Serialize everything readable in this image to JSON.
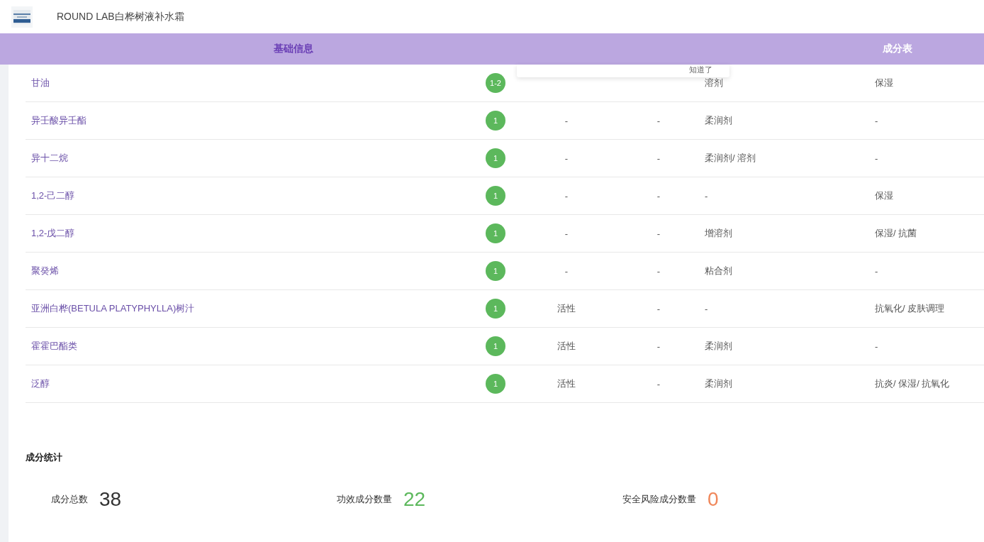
{
  "product": {
    "title": "ROUND LAB白桦树液补水霜"
  },
  "tabs": [
    {
      "label": "基础信息",
      "selected": true
    },
    {
      "label": "成分表",
      "selected": false
    }
  ],
  "popup": {
    "action": "知道了"
  },
  "ingredients": [
    {
      "name": "甘油",
      "score": "1-2",
      "column_5": "溶剂",
      "column_6": "保湿"
    },
    {
      "name": "异壬酸异壬酯",
      "score": "1",
      "column_3": "-",
      "column_4": "-",
      "column_5": "柔润剂",
      "column_6": "-"
    },
    {
      "name": "异十二烷",
      "score": "1",
      "column_3": "-",
      "column_4": "-",
      "column_5": "柔润剂/ 溶剂",
      "column_6": "-"
    },
    {
      "name": "1,2-己二醇",
      "score": "1",
      "column_3": "-",
      "column_4": "-",
      "column_5": "-",
      "column_6": "保湿"
    },
    {
      "name": "1,2-戊二醇",
      "score": "1",
      "column_3": "-",
      "column_4": "-",
      "column_5": "增溶剂",
      "column_6": "保湿/ 抗菌"
    },
    {
      "name": "聚癸烯",
      "score": "1",
      "column_3": "-",
      "column_4": "-",
      "column_5": "粘合剂",
      "column_6": "-"
    },
    {
      "name": "亚洲白桦(BETULA PLATYPHYLLA)树汁",
      "score": "1",
      "column_3": "活性",
      "column_4": "-",
      "column_5": "-",
      "column_6": "抗氧化/ 皮肤调理"
    },
    {
      "name": "霍霍巴酯类",
      "score": "1",
      "column_3": "活性",
      "column_4": "-",
      "column_5": "柔润剂",
      "column_6": "-"
    },
    {
      "name": "泛醇",
      "score": "1",
      "column_3": "活性",
      "column_4": "-",
      "column_5": "柔润剂",
      "column_6": "抗炎/ 保湿/ 抗氧化"
    }
  ],
  "stats": {
    "title": "成分统计",
    "items": [
      {
        "label": "成分总数",
        "value": "38",
        "color": "#333333"
      },
      {
        "label": "功效成分数量",
        "value": "22",
        "color": "#5cb85c"
      },
      {
        "label": "安全风险成分数量",
        "value": "0",
        "color": "#f0875a"
      }
    ]
  }
}
